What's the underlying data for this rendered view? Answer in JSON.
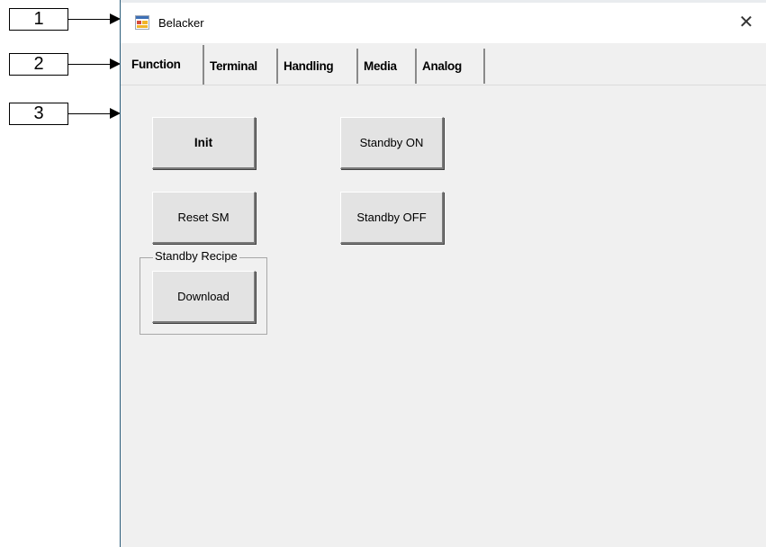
{
  "callouts": [
    "1",
    "2",
    "3"
  ],
  "window": {
    "title": "Belacker",
    "close_glyph": "✕"
  },
  "tabs": [
    {
      "label": "Function",
      "active": true
    },
    {
      "label": "Terminal",
      "active": false
    },
    {
      "label": "Handling",
      "active": false
    },
    {
      "label": "Media",
      "active": false
    },
    {
      "label": "Analog",
      "active": false
    }
  ],
  "function_panel": {
    "init_label": "Init",
    "reset_sm_label": "Reset SM",
    "standby_on_label": "Standby ON",
    "standby_off_label": "Standby OFF",
    "standby_recipe_group": {
      "title": "Standby Recipe",
      "download_label": "Download"
    }
  },
  "icons": {
    "app": "app-window-icon",
    "close": "close-icon"
  }
}
